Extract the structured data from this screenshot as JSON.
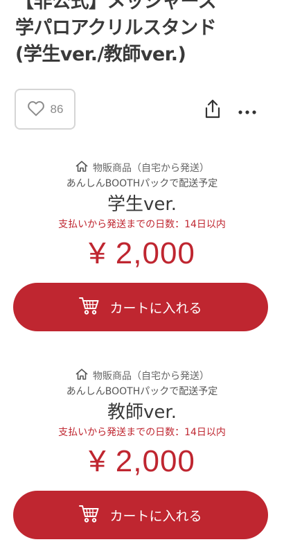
{
  "item": {
    "title_lines": [
      "【非公式】メッシャース",
      "学パロアクリルスタンド",
      "(学生ver./教師ver.)"
    ],
    "like_count": "86"
  },
  "icons": {
    "like": "heart-icon",
    "share": "share-icon",
    "more": "more-icon",
    "product_type": "home-icon",
    "cart": "cart-icon"
  },
  "variants": [
    {
      "type_label": "物販商品（自宅から発送）",
      "pack_label": "あんしんBOOTHパックで配送予定",
      "name": "学生ver.",
      "ship_days": "支払いから発送までの日数：14日以内",
      "price": "¥ 2,000",
      "cart_label": "カートに入れる"
    },
    {
      "type_label": "物販商品（自宅から発送）",
      "pack_label": "あんしんBOOTHパックで配送予定",
      "name": "教師ver.",
      "ship_days": "支払いから発送までの日数：14日以内",
      "price": "¥ 2,000",
      "cart_label": "カートに入れる"
    }
  ],
  "colors": {
    "accent": "#bf2630",
    "title": "#3a3a3a",
    "muted": "#666666",
    "border": "#d5d5d5"
  }
}
